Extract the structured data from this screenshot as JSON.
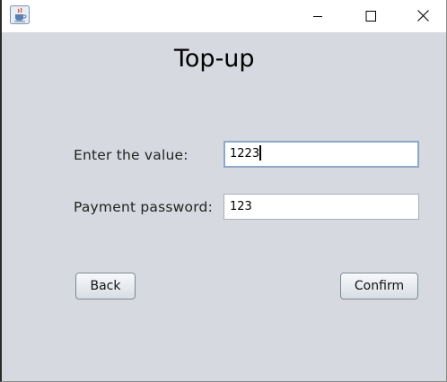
{
  "window": {
    "title": "",
    "icons": {
      "app": "java-cup-icon",
      "minimize": "minimize-icon",
      "maximize": "maximize-icon",
      "close": "close-icon"
    }
  },
  "form": {
    "title": "Top-up",
    "value_label": "Enter the value:",
    "value_input": "1223",
    "password_label": "Payment password:",
    "password_input": "123"
  },
  "buttons": {
    "back": "Back",
    "confirm": "Confirm"
  },
  "colors": {
    "content_background": "#d6d9e0",
    "focus_border": "#8da9c8"
  }
}
